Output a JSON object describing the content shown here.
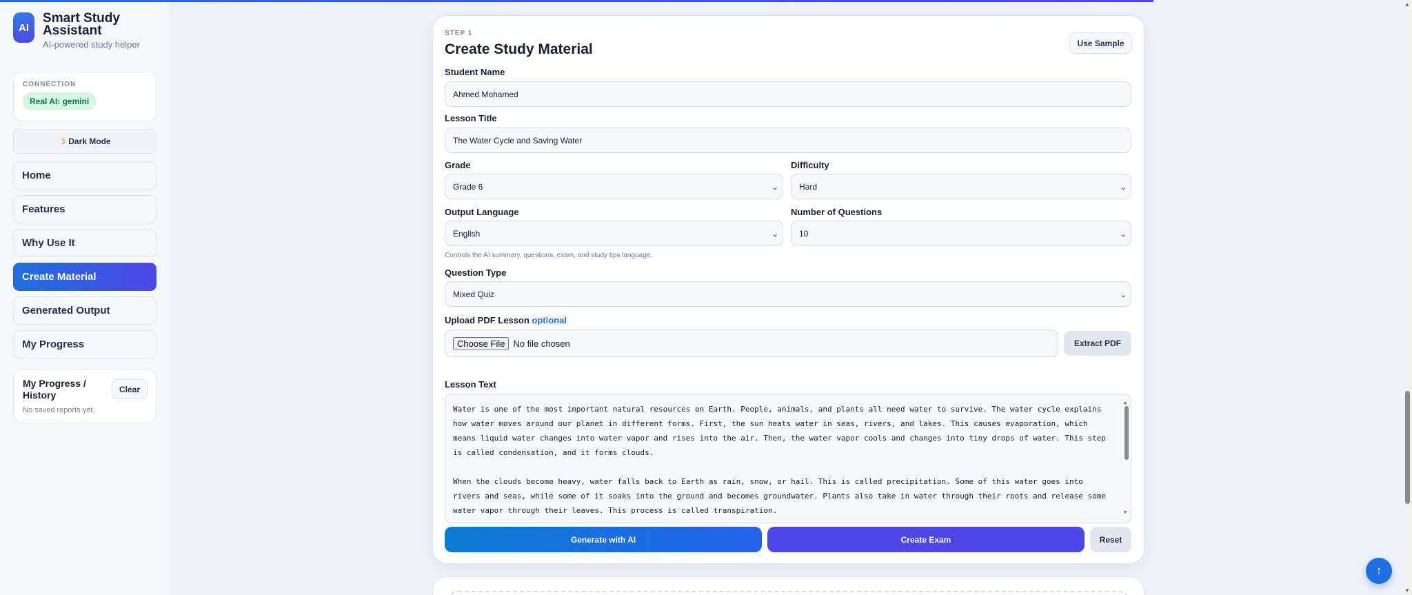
{
  "brand": {
    "logo": "AI",
    "title": "Smart Study Assistant",
    "subtitle": "AI-powered study helper"
  },
  "connection": {
    "label": "CONNECTION",
    "status": "Real AI: gemini"
  },
  "dark_mode": {
    "icon": "moon-icon",
    "label": "Dark Mode"
  },
  "nav": {
    "home": "Home",
    "features": "Features",
    "why": "Why Use It",
    "create": "Create Material",
    "output": "Generated Output",
    "progress": "My Progress"
  },
  "history": {
    "title": "My Progress / History",
    "empty": "No saved reports yet.",
    "clear": "Clear"
  },
  "form": {
    "step": "STEP 1",
    "title": "Create Study Material",
    "sample_btn": "Use Sample",
    "student_name_label": "Student Name",
    "student_name_value": "Ahmed Mohamed",
    "lesson_title_label": "Lesson Title",
    "lesson_title_value": "The Water Cycle and Saving Water",
    "grade_label": "Grade",
    "grade_value": "Grade 6",
    "difficulty_label": "Difficulty",
    "difficulty_value": "Hard",
    "language_label": "Output Language",
    "language_value": "English",
    "questions_label": "Number of Questions",
    "questions_value": "10",
    "language_hint": "Controls the AI summary, questions, exam, and study tips language.",
    "qtype_label": "Question Type",
    "qtype_value": "Mixed Quiz",
    "pdf_label": "Upload PDF Lesson",
    "pdf_optional": "optional",
    "choose_file": "Choose File",
    "no_file": "No file chosen",
    "extract_btn": "Extract PDF",
    "lesson_text_label": "Lesson Text",
    "lesson_text_p1": "Water is one of the most important natural resources on Earth. People, animals, and plants all need water to survive. The water cycle explains how water moves around our planet in different forms. First, the sun heats water in seas, rivers, and lakes. This causes evaporation, which means liquid water changes into water vapor and rises into the air. Then, the water vapor cools and changes into tiny drops of water. This step is called condensation, and it forms clouds.",
    "lesson_text_p2": "When the clouds become heavy, water falls back to Earth as rain, snow, or hail. This is called precipitation. Some of this water goes into rivers and seas, while some of it soaks into the ground and becomes groundwater. Plants also take in water through their roots and release some water vapor through their leaves. This process is called transpiration.",
    "generate_btn": "Generate with AI",
    "exam_btn": "Create Exam",
    "reset_btn": "Reset"
  },
  "scroll_top": "↑"
}
